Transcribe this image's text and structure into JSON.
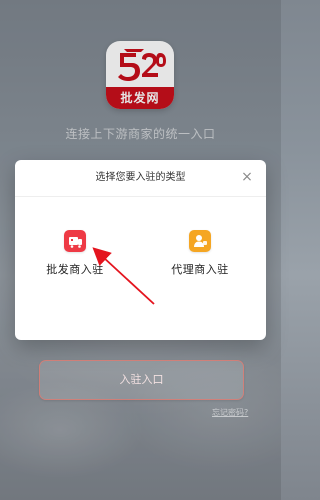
{
  "app": {
    "logo_text": "批发网",
    "tagline": "连接上下游商家的统一入口"
  },
  "modal": {
    "title": "选择您要入驻的类型",
    "close_glyph": "×",
    "options": [
      {
        "label": "批发商入驻",
        "icon": "wholesaler-icon",
        "color": "#ee3a45"
      },
      {
        "label": "代理商入驻",
        "icon": "agent-icon",
        "color": "#f5a623"
      }
    ]
  },
  "actions": {
    "join_label": "入驻入口",
    "forgot_label": "忘记密码?"
  },
  "colors": {
    "brand_red": "#c90f1b",
    "annotation_red": "#e4141e"
  }
}
